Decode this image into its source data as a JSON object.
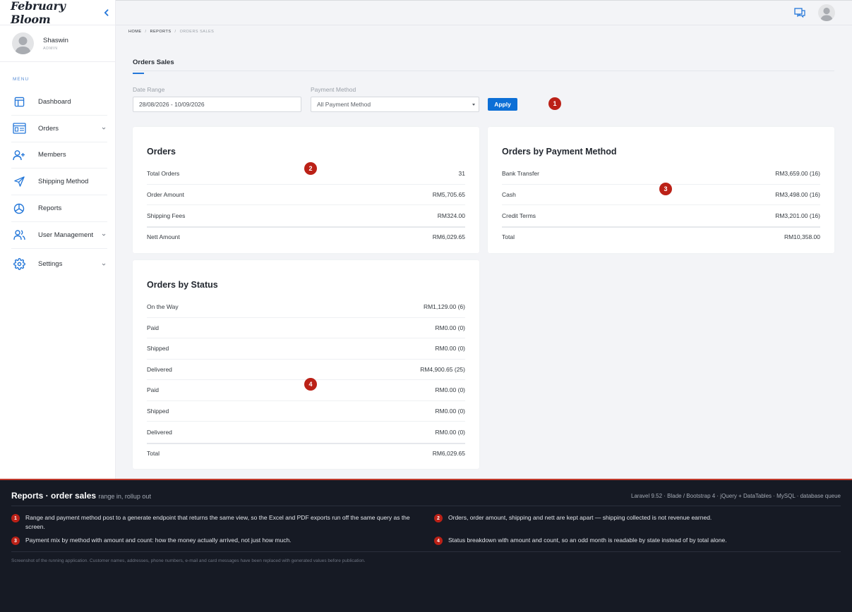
{
  "sidebar": {
    "brand": "February Bloom",
    "user": {
      "name": "Shaswin",
      "role": "ADMIN"
    },
    "menu_heading": "MENU",
    "items": [
      {
        "label": "Dashboard",
        "icon": "layout-icon",
        "has_children": false
      },
      {
        "label": "Orders",
        "icon": "orders-list-icon",
        "has_children": true
      },
      {
        "label": "Members",
        "icon": "user-plus-icon",
        "has_children": false
      },
      {
        "label": "Shipping Method",
        "icon": "send-icon",
        "has_children": false
      },
      {
        "label": "Reports",
        "icon": "pie-chart-icon",
        "has_children": false
      },
      {
        "label": "User Management",
        "icon": "users-icon",
        "has_children": true
      },
      {
        "label": "Settings",
        "icon": "gear-icon",
        "has_children": true
      }
    ]
  },
  "breadcrumb": {
    "home": "HOME",
    "reports": "REPORTS",
    "current": "ORDERS SALES"
  },
  "page_tab": "Orders Sales",
  "filters": {
    "date_label": "Date Range",
    "date_value": "28/08/2026 - 10/09/2026",
    "payment_label": "Payment Method",
    "payment_value": "All Payment Method",
    "apply_label": "Apply"
  },
  "markers": [
    "1",
    "2",
    "3",
    "4"
  ],
  "orders_card": {
    "title": "Orders",
    "rows": [
      {
        "label": "Total Orders",
        "value": "31"
      },
      {
        "label": "Order Amount",
        "value": "RM5,705.65"
      },
      {
        "label": "Shipping Fees",
        "value": "RM324.00"
      }
    ],
    "total": {
      "label": "Nett Amount",
      "value": "RM6,029.65"
    }
  },
  "payment_card": {
    "title": "Orders by Payment Method",
    "rows": [
      {
        "label": "Bank Transfer",
        "value": "RM3,659.00 (16)"
      },
      {
        "label": "Cash",
        "value": "RM3,498.00 (16)"
      },
      {
        "label": "Credit Terms",
        "value": "RM3,201.00 (16)"
      }
    ],
    "total": {
      "label": "Total",
      "value": "RM10,358.00"
    }
  },
  "status_card": {
    "title": "Orders by Status",
    "rows": [
      {
        "label": "On the Way",
        "value": "RM1,129.00 (6)"
      },
      {
        "label": "Paid",
        "value": "RM0.00 (0)"
      },
      {
        "label": "Shipped",
        "value": "RM0.00 (0)"
      },
      {
        "label": "Delivered",
        "value": "RM4,900.65 (25)"
      },
      {
        "label": "Paid",
        "value": "RM0.00 (0)"
      },
      {
        "label": "Shipped",
        "value": "RM0.00 (0)"
      },
      {
        "label": "Delivered",
        "value": "RM0.00 (0)"
      }
    ],
    "total": {
      "label": "Total",
      "value": "RM6,029.65"
    }
  },
  "footer": {
    "title": "Reports · order sales",
    "subtitle": "range in, rollup out",
    "tech": "Laravel 9.52 · Blade / Bootstrap 4 · jQuery + DataTables · MySQL · database queue",
    "notes": [
      {
        "num": "1",
        "text": "Range and payment method post to a generate endpoint that returns the same view, so the Excel and PDF exports run off the same query as the screen."
      },
      {
        "num": "2",
        "text": "Orders, order amount, shipping and nett are kept apart — shipping collected is not revenue earned."
      },
      {
        "num": "3",
        "text": "Payment mix by method with amount and count: how the money actually arrived, not just how much."
      },
      {
        "num": "4",
        "text": "Status breakdown with amount and count, so an odd month is readable by state instead of by total alone."
      }
    ],
    "disclaimer": "Screenshot of the running application. Customer names, addresses, phone numbers, e-mail and card messages have been replaced with generated values before publication."
  },
  "colors": {
    "accent": "#0d6fd6",
    "marker": "#bb2117",
    "footer_bg": "#161a24"
  }
}
